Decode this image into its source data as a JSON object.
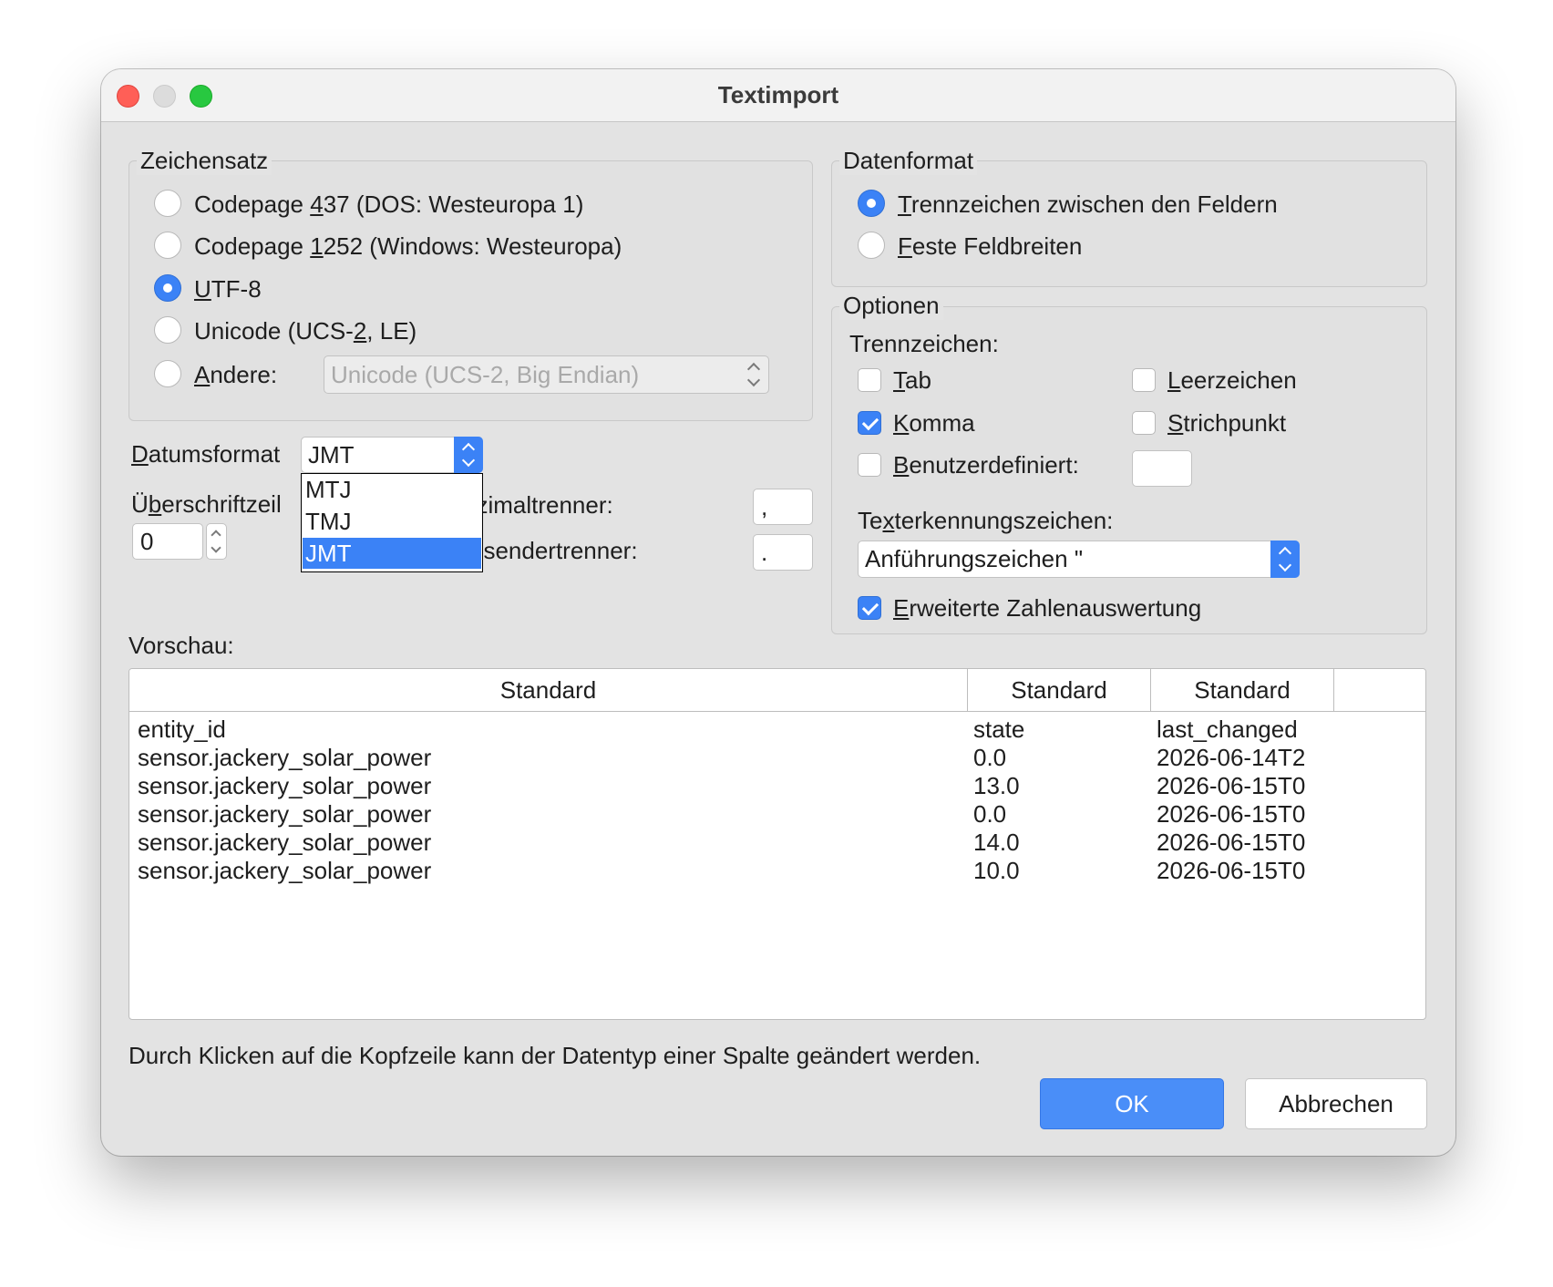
{
  "window": {
    "title": "Textimport"
  },
  "charset": {
    "legend": "Zeichensatz",
    "options": [
      {
        "pre": "Codepage ",
        "mn": "4",
        "post": "37 (DOS: Westeuropa 1)",
        "selected": false
      },
      {
        "pre": "Codepage ",
        "mn": "1",
        "post": "252 (Windows: Westeuropa)",
        "selected": false
      },
      {
        "pre": "",
        "mn": "U",
        "post": "TF-8",
        "selected": true
      },
      {
        "pre": "Unicode (UCS-",
        "mn": "2",
        "post": ", LE)",
        "selected": false
      },
      {
        "pre": "",
        "mn": "A",
        "post": "ndere:",
        "selected": false
      }
    ],
    "other_value": "Unicode (UCS-2, Big Endian)"
  },
  "date_format": {
    "label_mn": "D",
    "label_rest": "atumsformat",
    "value": "JMT",
    "options": [
      "MTJ",
      "TMJ",
      "JMT"
    ]
  },
  "header_row": {
    "label_pre": "Ü",
    "label_mn": "b",
    "label_rest": "erschriftzeil",
    "value": "0"
  },
  "decimal_sep": {
    "label": "ezimaltrenner:",
    "value": ","
  },
  "thousands_sep": {
    "label": "usendertrenner:",
    "value": "."
  },
  "data_format": {
    "legend": "Datenformat",
    "options": [
      {
        "mn": "T",
        "rest": "rennzeichen zwischen den Feldern",
        "selected": true
      },
      {
        "mn": "F",
        "rest": "este Feldbreiten",
        "selected": false
      }
    ]
  },
  "options": {
    "legend": "Optionen",
    "separators_label": "Trennzeichen:",
    "tab": {
      "mn": "T",
      "rest": "ab",
      "checked": false
    },
    "space": {
      "mn": "L",
      "rest": "eerzeichen",
      "checked": false
    },
    "comma": {
      "mn": "K",
      "rest": "omma",
      "checked": true
    },
    "semicolon": {
      "mn": "S",
      "rest": "trichpunkt",
      "checked": false
    },
    "custom": {
      "mn": "B",
      "rest": "enutzerdefiniert:",
      "checked": false,
      "value": ""
    },
    "text_qualifier_pre": "Te",
    "text_qualifier_mn": "x",
    "text_qualifier_rest": "terkennungszeichen:",
    "text_qualifier_value": "Anführungszeichen \"",
    "extended": {
      "mn": "E",
      "rest": "rweiterte Zahlenauswertung",
      "checked": true
    }
  },
  "preview": {
    "label": "Vorschau:",
    "columns": [
      "Standard",
      "Standard",
      "Standard"
    ],
    "rows": [
      [
        "entity_id",
        "state",
        "last_changed"
      ],
      [
        "sensor.jackery_solar_power",
        "0.0",
        "2026-06-14T2"
      ],
      [
        "sensor.jackery_solar_power",
        "13.0",
        "2026-06-15T0"
      ],
      [
        "sensor.jackery_solar_power",
        "0.0",
        "2026-06-15T0"
      ],
      [
        "sensor.jackery_solar_power",
        "14.0",
        "2026-06-15T0"
      ],
      [
        "sensor.jackery_solar_power",
        "10.0",
        "2026-06-15T0"
      ]
    ]
  },
  "hint": "Durch Klicken auf die Kopfzeile kann der Datentyp einer Spalte geändert werden.",
  "buttons": {
    "ok": "OK",
    "cancel": "Abbrechen"
  },
  "colors": {
    "accent": "#3b82f6",
    "window_bg": "#e3e3e3",
    "close": "#ff5f57",
    "maximize": "#28c840"
  }
}
